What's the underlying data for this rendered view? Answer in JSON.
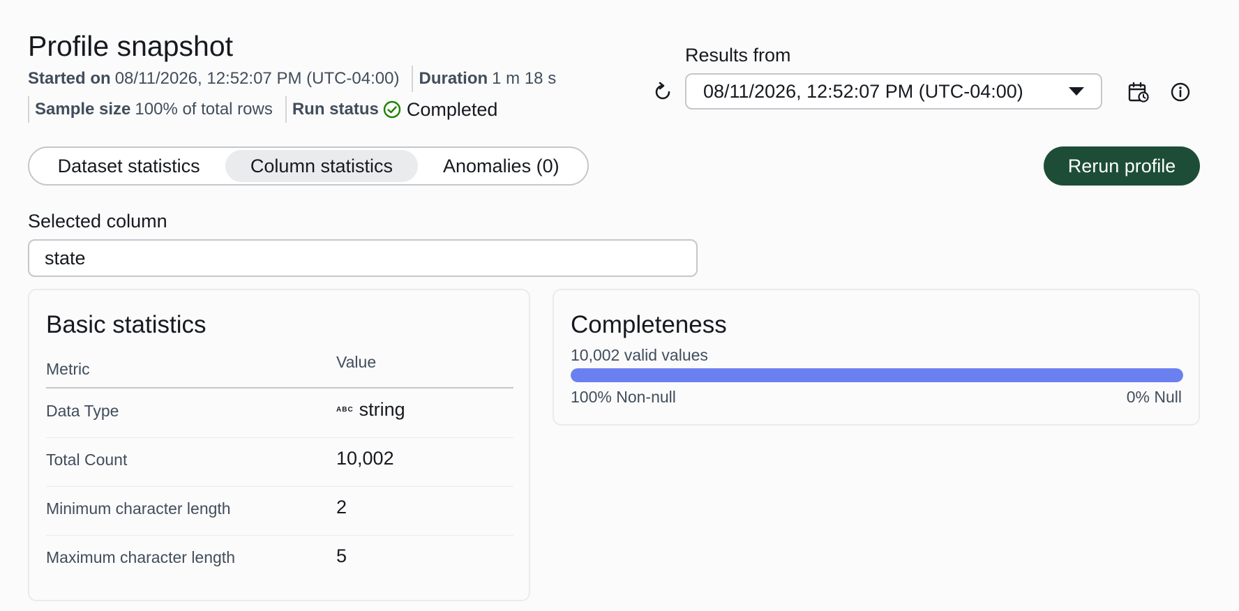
{
  "header": {
    "title": "Profile snapshot",
    "started_label": "Started on",
    "started_value": "08/11/2026, 12:52:07 PM (UTC-04:00)",
    "duration_label": "Duration",
    "duration_value": "1 m 18 s",
    "sample_label": "Sample size",
    "sample_value": "100% of total rows",
    "status_label": "Run status",
    "status_value": "Completed",
    "status_color": "#1d8102"
  },
  "results": {
    "label": "Results from",
    "selected": "08/11/2026, 12:52:07 PM (UTC-04:00)",
    "icons": [
      "refresh-icon",
      "calendar-clock-icon",
      "info-icon"
    ]
  },
  "tabs": [
    {
      "label": "Dataset statistics",
      "selected": false
    },
    {
      "label": "Column statistics",
      "selected": true
    },
    {
      "label": "Anomalies (0)",
      "selected": false
    }
  ],
  "rerun_label": "Rerun profile",
  "brand_color": "#1e4d37",
  "selected_column": {
    "label": "Selected column",
    "value": "state"
  },
  "basic_stats": {
    "title": "Basic statistics",
    "col_metric": "Metric",
    "col_value": "Value",
    "rows": [
      {
        "metric": "Data Type",
        "value": "string",
        "icon_text": "ABC"
      },
      {
        "metric": "Total Count",
        "value": "10,002"
      },
      {
        "metric": "Minimum character length",
        "value": "2"
      },
      {
        "metric": "Maximum character length",
        "value": "5"
      }
    ]
  },
  "completeness": {
    "title": "Completeness",
    "valid_text": "10,002 valid values",
    "non_null_label": "100% Non-null",
    "null_label": "0% Null",
    "non_null_fraction": 1.0,
    "bar_color": "#6b80f0"
  }
}
